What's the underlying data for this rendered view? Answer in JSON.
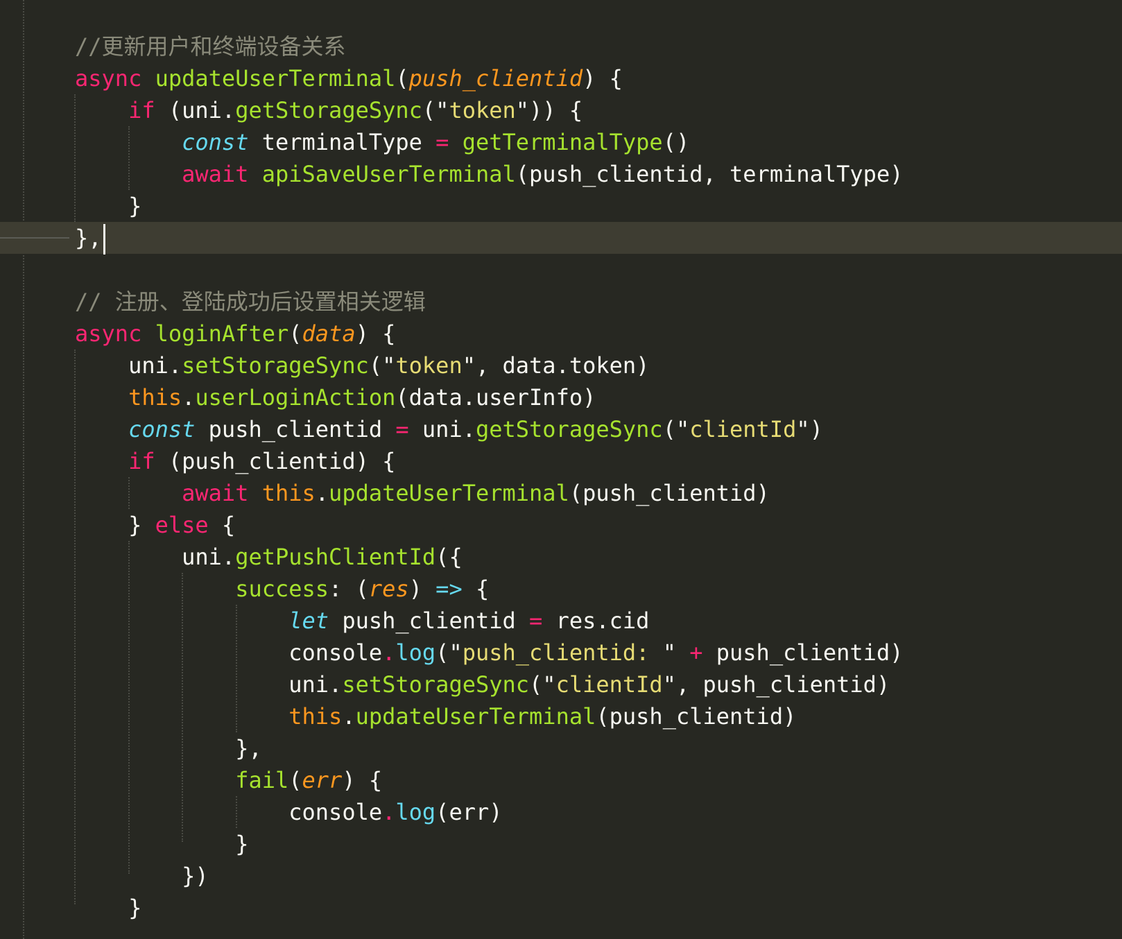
{
  "editor": {
    "cursor_line": 7,
    "lines": [
      [
        {
          "t": "//更新用户和终端设备关系",
          "c": "cmt"
        }
      ],
      [
        {
          "t": "async",
          "c": "kw"
        },
        {
          "t": " "
        },
        {
          "t": "updateUserTerminal",
          "c": "fn"
        },
        {
          "t": "("
        },
        {
          "t": "push_clientid",
          "c": "param"
        },
        {
          "t": ") {"
        }
      ],
      [
        {
          "t": "    "
        },
        {
          "t": "if",
          "c": "kw"
        },
        {
          "t": " (uni."
        },
        {
          "t": "getStorageSync",
          "c": "fn"
        },
        {
          "t": "(\""
        },
        {
          "t": "token",
          "c": "str"
        },
        {
          "t": "\")) {"
        }
      ],
      [
        {
          "t": "        "
        },
        {
          "t": "const",
          "c": "sto"
        },
        {
          "t": " terminalType "
        },
        {
          "t": "=",
          "c": "op"
        },
        {
          "t": " "
        },
        {
          "t": "getTerminalType",
          "c": "fn"
        },
        {
          "t": "()"
        }
      ],
      [
        {
          "t": "        "
        },
        {
          "t": "await",
          "c": "kw"
        },
        {
          "t": " "
        },
        {
          "t": "apiSaveUserTerminal",
          "c": "fn"
        },
        {
          "t": "(push_clientid, terminalType)"
        }
      ],
      [
        {
          "t": "    }"
        }
      ],
      [
        {
          "t": "},"
        }
      ],
      [
        {
          "t": ""
        }
      ],
      [
        {
          "t": "// 注册、登陆成功后设置相关逻辑",
          "c": "cmt"
        }
      ],
      [
        {
          "t": "async",
          "c": "kw"
        },
        {
          "t": " "
        },
        {
          "t": "loginAfter",
          "c": "fn"
        },
        {
          "t": "("
        },
        {
          "t": "data",
          "c": "param"
        },
        {
          "t": ") {"
        }
      ],
      [
        {
          "t": "    uni."
        },
        {
          "t": "setStorageSync",
          "c": "fn"
        },
        {
          "t": "(\""
        },
        {
          "t": "token",
          "c": "str"
        },
        {
          "t": "\", data.token)"
        }
      ],
      [
        {
          "t": "    "
        },
        {
          "t": "this",
          "c": "this"
        },
        {
          "t": "."
        },
        {
          "t": "userLoginAction",
          "c": "fn"
        },
        {
          "t": "(data.userInfo)"
        }
      ],
      [
        {
          "t": "    "
        },
        {
          "t": "const",
          "c": "sto"
        },
        {
          "t": " push_clientid "
        },
        {
          "t": "=",
          "c": "op"
        },
        {
          "t": " uni."
        },
        {
          "t": "getStorageSync",
          "c": "fn"
        },
        {
          "t": "(\""
        },
        {
          "t": "clientId",
          "c": "str"
        },
        {
          "t": "\")"
        }
      ],
      [
        {
          "t": "    "
        },
        {
          "t": "if",
          "c": "kw"
        },
        {
          "t": " (push_clientid) {"
        }
      ],
      [
        {
          "t": "        "
        },
        {
          "t": "await",
          "c": "kw"
        },
        {
          "t": " "
        },
        {
          "t": "this",
          "c": "this"
        },
        {
          "t": "."
        },
        {
          "t": "updateUserTerminal",
          "c": "fn"
        },
        {
          "t": "(push_clientid)"
        }
      ],
      [
        {
          "t": "    } "
        },
        {
          "t": "else",
          "c": "kw"
        },
        {
          "t": " {"
        }
      ],
      [
        {
          "t": "        uni."
        },
        {
          "t": "getPushClientId",
          "c": "fn"
        },
        {
          "t": "({"
        }
      ],
      [
        {
          "t": "            "
        },
        {
          "t": "success",
          "c": "fn"
        },
        {
          "t": ": ("
        },
        {
          "t": "res",
          "c": "param"
        },
        {
          "t": ") "
        },
        {
          "t": "=>",
          "c": "sto"
        },
        {
          "t": " {"
        }
      ],
      [
        {
          "t": "                "
        },
        {
          "t": "let",
          "c": "sto"
        },
        {
          "t": " push_clientid "
        },
        {
          "t": "=",
          "c": "op"
        },
        {
          "t": " res.cid"
        }
      ],
      [
        {
          "t": "                console"
        },
        {
          "t": ".",
          "c": "op"
        },
        {
          "t": "log",
          "c": "prop"
        },
        {
          "t": "(\""
        },
        {
          "t": "push_clientid: ",
          "c": "str"
        },
        {
          "t": "\" "
        },
        {
          "t": "+",
          "c": "op"
        },
        {
          "t": " push_clientid)"
        }
      ],
      [
        {
          "t": "                uni."
        },
        {
          "t": "setStorageSync",
          "c": "fn"
        },
        {
          "t": "(\""
        },
        {
          "t": "clientId",
          "c": "str"
        },
        {
          "t": "\", push_clientid)"
        }
      ],
      [
        {
          "t": "                "
        },
        {
          "t": "this",
          "c": "this"
        },
        {
          "t": "."
        },
        {
          "t": "updateUserTerminal",
          "c": "fn"
        },
        {
          "t": "(push_clientid)"
        }
      ],
      [
        {
          "t": "            },"
        }
      ],
      [
        {
          "t": "            "
        },
        {
          "t": "fail",
          "c": "fn"
        },
        {
          "t": "("
        },
        {
          "t": "err",
          "c": "param"
        },
        {
          "t": ") {"
        }
      ],
      [
        {
          "t": "                console"
        },
        {
          "t": ".",
          "c": "op"
        },
        {
          "t": "log",
          "c": "prop"
        },
        {
          "t": "(err)"
        }
      ],
      [
        {
          "t": "            }"
        }
      ],
      [
        {
          "t": "        })"
        }
      ],
      [
        {
          "t": "    }"
        }
      ]
    ]
  }
}
